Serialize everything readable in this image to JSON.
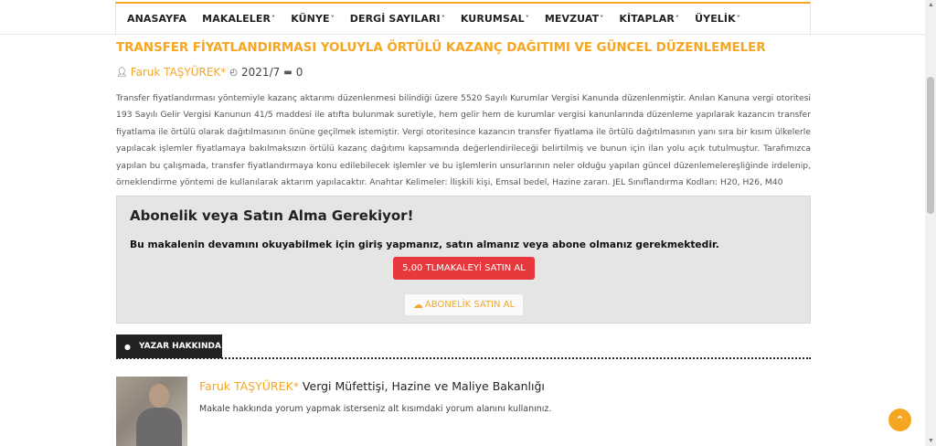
{
  "nav": {
    "items": [
      {
        "label": "ANASAYFA",
        "has_dropdown": false
      },
      {
        "label": "MAKALELER",
        "has_dropdown": true
      },
      {
        "label": "KÜNYE",
        "has_dropdown": true
      },
      {
        "label": "DERGİ SAYILARI",
        "has_dropdown": true
      },
      {
        "label": "KURUMSAL",
        "has_dropdown": true
      },
      {
        "label": "MEVZUAT",
        "has_dropdown": true
      },
      {
        "label": "KİTAPLAR",
        "has_dropdown": true
      },
      {
        "label": "ÜYELİK",
        "has_dropdown": true
      }
    ],
    "chevron": "˅"
  },
  "article": {
    "title": "TRANSFER FİYATLANDIRMASI YOLUYLA ÖRTÜLÜ KAZANÇ DAĞITIMI VE GÜNCEL DÜZENLEMELER",
    "author": "Faruk TAŞYÜREK*",
    "date": "2021/7",
    "comment_count": "0",
    "abstract": "Transfer fiyatlandırması yöntemiyle kazanç aktarımı düzenlenmesi bilindiği üzere 5520 Sayılı Kurumlar Vergisi Kanunda düzenlenmiştir. Anılan Kanuna vergi otoritesi 193 Sayılı Gelir Vergisi Kanunun 41/5 maddesi ile atıfta bulunmak suretiyle, hem gelir hem de kurumlar vergisi kanunlarında düzenleme yapılarak kazancın transfer fiyatlama ile örtülü olarak dağıtılmasının önüne geçilmek istemiştir. Vergi otoritesince kazancın transfer fiyatlama ile örtülü dağıtılmasının yanı sıra bir kısım ülkelerle yapılacak işlemler fiyatlamaya bakılmaksızın örtülü kazanç dağıtımı kapsamında değerlendirileceği belirtilmiş ve bunun için ilan yolu açık tutulmuştur. Tarafımızca yapılan bu çalışmada, transfer fiyatlandırmaya konu edilebilecek işlemler ve bu işlemlerin unsurlarının neler olduğu yapılan güncel düzenlemelereşliğinde irdelenip, örneklendirme yöntemi de kullanılarak aktarım yapılacaktır. Anahtar Kelimeler: İlişkili kişi, Emsal bedel, Hazine zararı. JEL Sınıflandırma Kodları: H20, H26, M40"
  },
  "paywall": {
    "heading": "Abonelik veya Satın Alma Gerekiyor!",
    "message": "Bu makalenin devamını okuyabilmek için giriş yapmanız, satın almanız veya abone olmanız gerekmektedir.",
    "buy_label": "5,00 TLMAKALEYİ SATIN AL",
    "subscribe_label": "ABONELİK SATIN AL",
    "buy_color": "#e8383d"
  },
  "author_section": {
    "tab_label": "YAZAR HAKKINDA",
    "name": "Faruk TAŞYÜREK*",
    "title": " Vergi Müfettişi, Hazine ve Maliye Bakanlığı",
    "note": "Makale hakkında yorum yapmak isterseniz alt kısımdaki yorum alanını kullanınız."
  },
  "colors": {
    "accent": "#f5a623",
    "dark": "#222222"
  },
  "icons": {
    "author": "user-icon",
    "date": "clock-icon",
    "comments": "comment-icon",
    "cloud": "cloud-icon",
    "scroll_top": "chevron-up-icon"
  }
}
